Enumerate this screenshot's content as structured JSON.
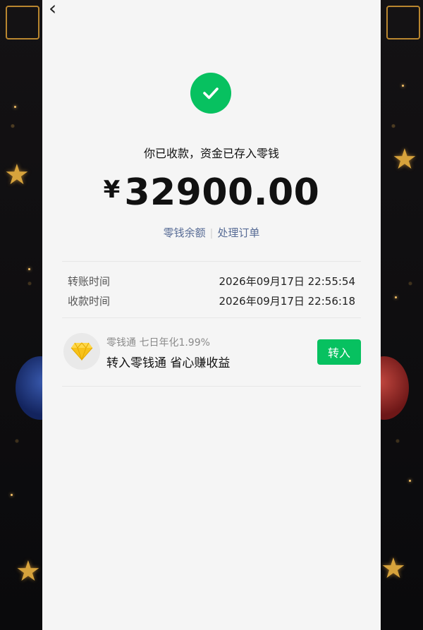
{
  "nav": {
    "back_glyph": "‹"
  },
  "status": {
    "icon": "check-circle-icon",
    "color": "#07c160",
    "message": "你已收款，资金已存入零钱"
  },
  "amount": {
    "currency": "¥",
    "value": "32900.00"
  },
  "links": {
    "balance": "零钱余额",
    "orders": "处理订单",
    "color": "#576b95"
  },
  "details": [
    {
      "label": "转账时间",
      "value": "2026年09月17日 22:55:54"
    },
    {
      "label": "收款时间",
      "value": "2026年09月17日 22:56:18"
    }
  ],
  "promo": {
    "icon": "diamond-icon",
    "subtitle": "零钱通 七日年化1.99%",
    "title": "转入零钱通 省心赚收益",
    "button_label": "转入"
  }
}
